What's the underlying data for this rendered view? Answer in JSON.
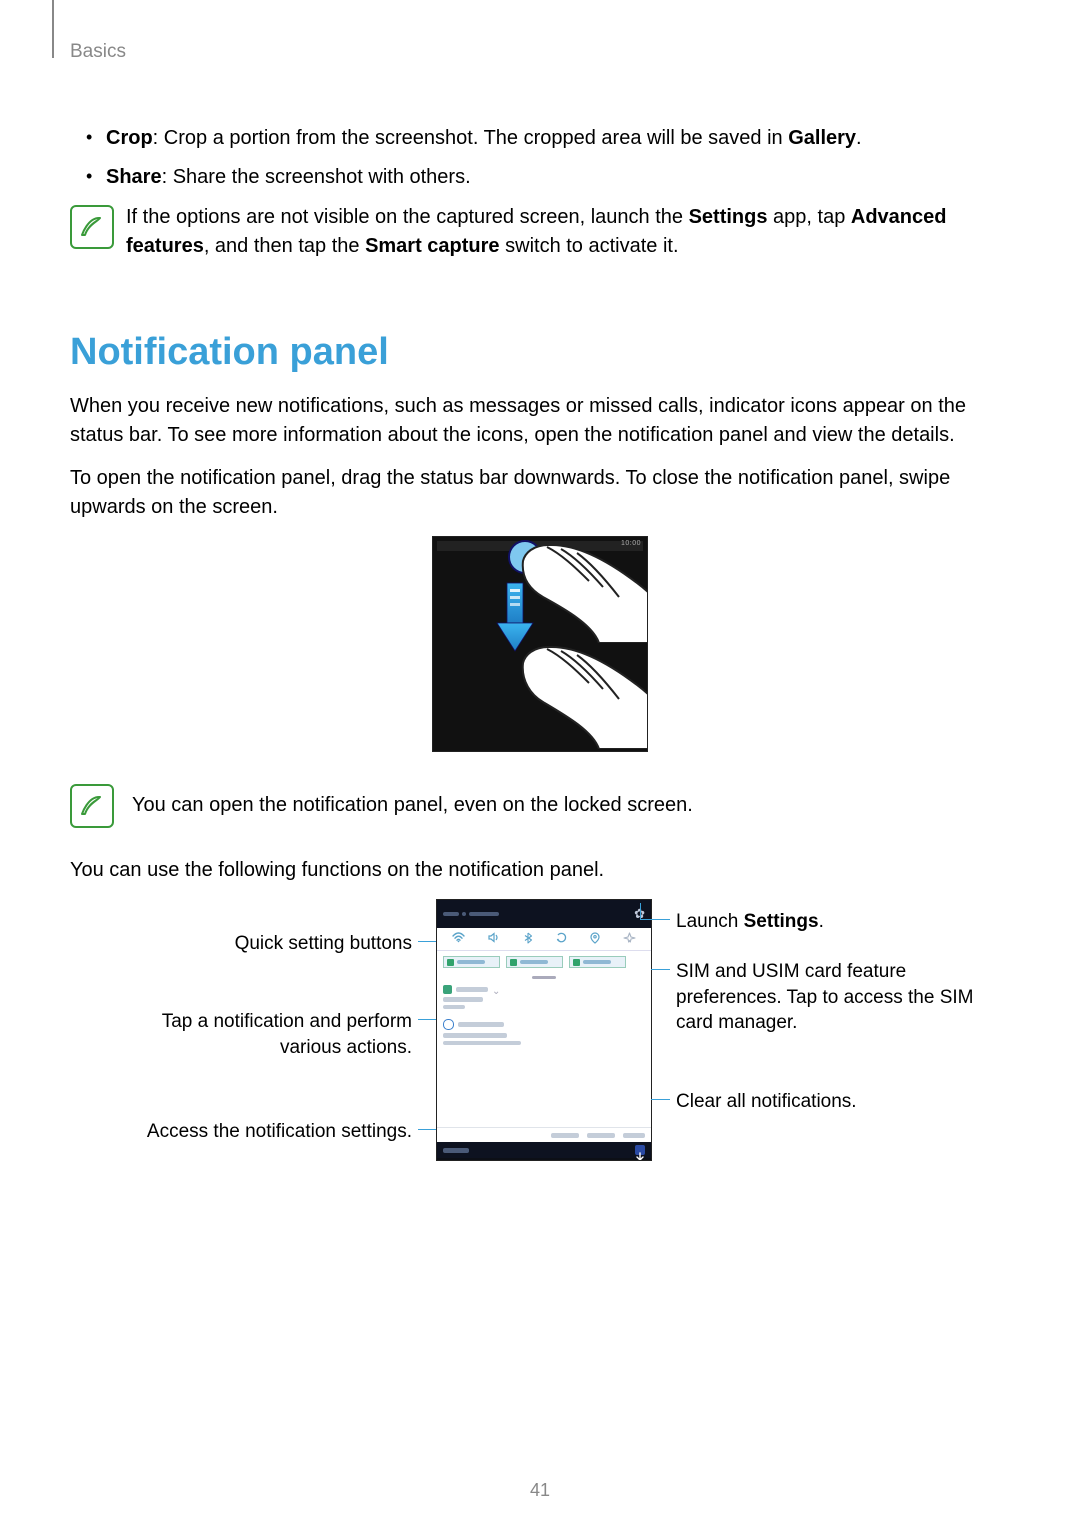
{
  "header": {
    "section": "Basics"
  },
  "bullets": {
    "crop": {
      "term": "Crop",
      "text": ": Crop a portion from the screenshot. The cropped area will be saved in ",
      "term2": "Gallery",
      "tail": "."
    },
    "share": {
      "term": "Share",
      "text": ": Share the screenshot with others."
    }
  },
  "note1": {
    "pre": "If the options are not visible on the captured screen, launch the ",
    "settings": "Settings",
    "mid": " app, tap ",
    "adv": "Advanced features",
    "mid2": ", and then tap the ",
    "smart": "Smart capture",
    "post": " switch to activate it."
  },
  "heading": "Notification panel",
  "para1": "When you receive new notifications, such as messages or missed calls, indicator icons appear on the status bar. To see more information about the icons, open the notification panel and view the details.",
  "para2": "To open the notification panel, drag the status bar downwards. To close the notification panel, swipe upwards on the screen.",
  "note2": "You can open the notification panel, even on the locked screen.",
  "para3": "You can use the following functions on the notification panel.",
  "callouts": {
    "r1a": "Launch ",
    "r1b": "Settings",
    "r1c": ".",
    "l1": "Quick setting buttons",
    "r2": "SIM and USIM card feature preferences. Tap to access the SIM card manager.",
    "l2": "Tap a notification and perform various actions.",
    "r3": "Clear all notifications.",
    "l3": "Access the notification settings."
  },
  "pageNumber": "41",
  "fig1_status": "10:00"
}
